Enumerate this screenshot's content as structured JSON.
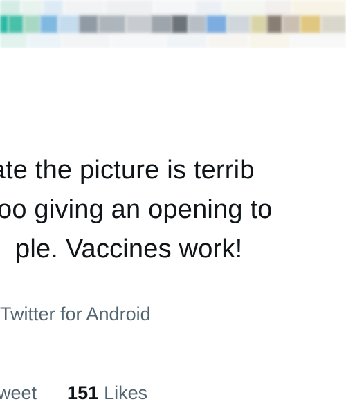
{
  "tweet": {
    "lines": [
      "iate the picture is terrib",
      "oo giving an opening to",
      "ple. Vaccines work!"
    ],
    "source": "Twitter for Android"
  },
  "stats": {
    "retweets_label": "weet",
    "likes_count": "151",
    "likes_label": "Likes"
  },
  "colors": {
    "text_primary": "#0f1419",
    "text_secondary": "#536471",
    "divider": "#eff3f4"
  }
}
